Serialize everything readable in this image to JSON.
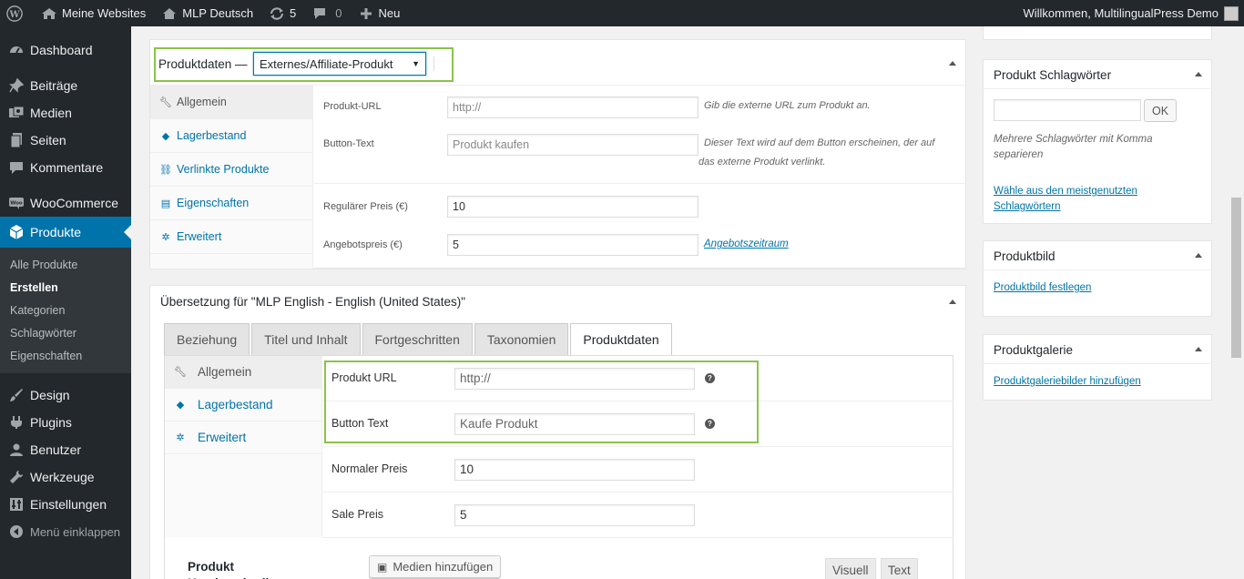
{
  "adminbar": {
    "my_sites": "Meine Websites",
    "site_name": "MLP Deutsch",
    "updates_count": "5",
    "comments_count": "0",
    "new_label": "Neu",
    "welcome": "Willkommen, MultilingualPress Demo"
  },
  "sidebar": {
    "dashboard": "Dashboard",
    "posts": "Beiträge",
    "media": "Medien",
    "pages": "Seiten",
    "comments": "Kommentare",
    "woocommerce": "WooCommerce",
    "products": "Produkte",
    "submenu": [
      "Alle Produkte",
      "Erstellen",
      "Kategorien",
      "Schlagwörter",
      "Eigenschaften"
    ],
    "design": "Design",
    "plugins": "Plugins",
    "users": "Benutzer",
    "tools": "Werkzeuge",
    "settings": "Einstellungen",
    "collapse": "Menü einklappen"
  },
  "product_data": {
    "title": "Produktdaten —",
    "type_value": "Externes/Affiliate-Produkt",
    "tabs": [
      "Allgemein",
      "Lagerbestand",
      "Verlinkte Produkte",
      "Eigenschaften",
      "Erweitert"
    ],
    "url_label": "Produkt-URL",
    "url_placeholder": "http://",
    "url_desc": "Gib die externe URL zum Produkt an.",
    "button_label": "Button-Text",
    "button_placeholder": "Produkt kaufen",
    "button_desc_1": "Dieser Text wird auf dem Button erscheinen, der auf",
    "button_desc_2": "das externe Produkt verlinkt.",
    "regular_label": "Regulärer Preis (€)",
    "regular_value": "10",
    "sale_label": "Angebotspreis (€)",
    "sale_value": "5",
    "sale_link": "Angebotszeitraum"
  },
  "translation": {
    "title": "Übersetzung für \"MLP English - English (United States)\"",
    "tabs": [
      "Beziehung",
      "Titel und Inhalt",
      "Fortgeschritten",
      "Taxonomien",
      "Produktdaten"
    ],
    "side_tabs": [
      "Allgemein",
      "Lagerbestand",
      "Erweitert"
    ],
    "url_label": "Produkt URL",
    "url_value": "http://",
    "button_label": "Button Text",
    "button_value": "Kaufe Produkt",
    "normal_label": "Normaler Preis",
    "normal_value": "10",
    "sale_label": "Sale Preis",
    "sale_value": "5",
    "editor_label": "Produkt Kurzbeschreibung",
    "media_button": "Medien hinzufügen",
    "visual_tab": "Visuell",
    "text_tab": "Text"
  },
  "right": {
    "tags_title": "Produkt Schlagwörter",
    "ok": "OK",
    "tags_hint": "Mehrere Schlagwörter mit Komma separieren",
    "tags_link": "Wähle aus den meistgenutzten Schlagwörtern",
    "image_title": "Produktbild",
    "image_link": "Produktbild festlegen",
    "gallery_title": "Produktgalerie",
    "gallery_link": "Produktgaleriebilder hinzufügen"
  }
}
